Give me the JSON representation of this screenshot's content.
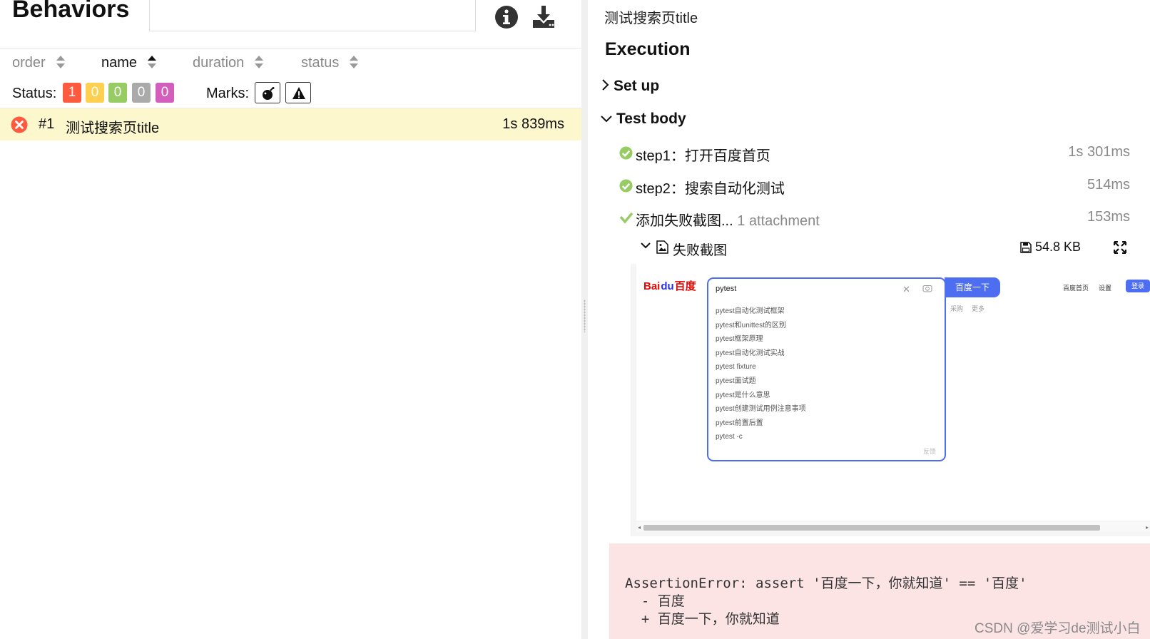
{
  "header": {
    "title": "Behaviors",
    "search_value": ""
  },
  "sort": {
    "order": "order",
    "name": "name",
    "duration": "duration",
    "status": "status"
  },
  "status_filter": {
    "label": "Status:",
    "counts": [
      {
        "status": "failed",
        "value": "1",
        "color": "#fd5a3e"
      },
      {
        "status": "broken",
        "value": "0",
        "color": "#ffd050"
      },
      {
        "status": "passed",
        "value": "0",
        "color": "#97cc64"
      },
      {
        "status": "skipped",
        "value": "0",
        "color": "#aaaaaa"
      },
      {
        "status": "unknown",
        "value": "0",
        "color": "#d35ebe"
      }
    ]
  },
  "marks": {
    "label": "Marks:",
    "icons": [
      "flaky-bomb-icon",
      "new-failed-warning-icon"
    ]
  },
  "test_list": [
    {
      "num": "#1",
      "name": "测试搜索页title",
      "duration": "1s 839ms",
      "status": "failed",
      "status_icon": "failed-icon"
    }
  ],
  "detail": {
    "title": "测试搜索页title",
    "execution": "Execution",
    "setup": "Set up",
    "body": "Test body",
    "steps": [
      {
        "name": "step1：打开百度首页",
        "duration": "1s 301ms",
        "status": "passed"
      },
      {
        "name": "step2：搜索自动化测试",
        "duration": "514ms",
        "status": "passed"
      },
      {
        "name": "添加失败截图...",
        "attachments": "1 attachment",
        "duration": "153ms",
        "status": "passed"
      }
    ],
    "attachment": {
      "name": "失败截图",
      "size": "54.8 KB"
    },
    "error_lines": [
      "AssertionError: assert '百度一下，你就知道' == '百度'",
      "  - 百度",
      "  + 百度一下，你就知道"
    ]
  },
  "preview": {
    "logo_left": "Bai",
    "logo_paw": "du",
    "logo_right": "百度",
    "query": "pytest",
    "button": "百度一下",
    "suggestions": [
      "pytest自动化测试框架",
      "pytest和unittest的区别",
      "pytest框架原理",
      "pytest自动化测试实战",
      "pytest fixture",
      "pytest面试题",
      "pytest是什么意思",
      "pytest创建测试用例注意事项",
      "pytest前置后置",
      "pytest -c"
    ],
    "feedback": "反馈",
    "links": [
      "采购",
      "更多"
    ],
    "top_links": [
      "百度首页",
      "设置"
    ],
    "login": "登录"
  },
  "watermark": "CSDN @爱学习de测试小白"
}
